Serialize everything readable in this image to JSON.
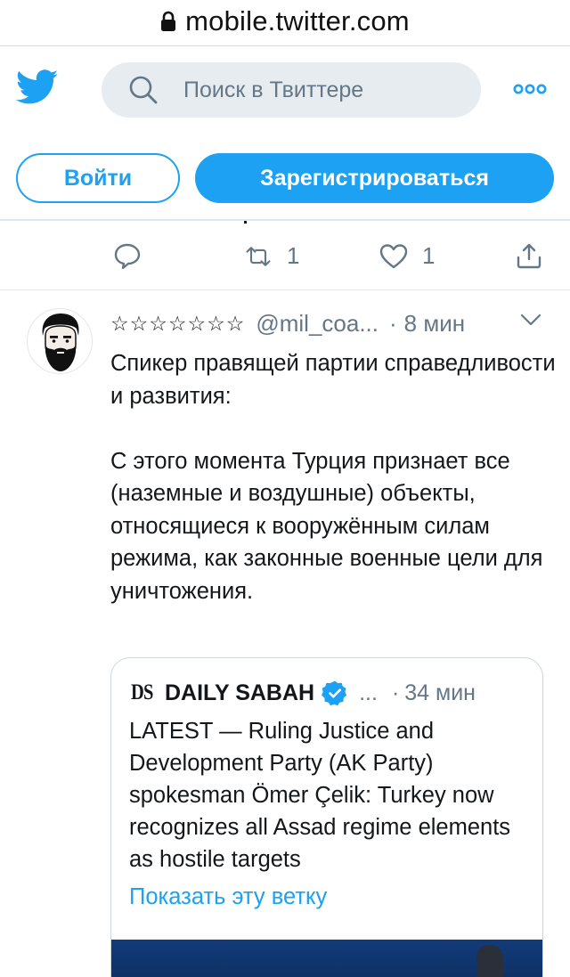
{
  "browser": {
    "url": "mobile.twitter.com"
  },
  "header": {
    "search_placeholder": "Поиск в Твиттере",
    "login_label": "Войти",
    "signup_label": "Зарегистрироваться"
  },
  "prev_tweet": {
    "retweets": "1",
    "likes": "1"
  },
  "tweet": {
    "name": "☆☆☆☆☆☆☆",
    "handle": "@mil_coa...",
    "separator": "·",
    "time": "8 мин",
    "text": "Спикер правящей партии справедливости и развития:\n\nС этого момента Турция признает все (наземные и воздушные) объекты, относящиеся к вооружённым силам режима, как законные военные цели для уничтожения."
  },
  "quoted": {
    "logo": "DS",
    "name": "DAILY SABAH",
    "ellipsis": "...",
    "separator": "·",
    "time": "34 мин",
    "text": "LATEST — Ruling Justice and Development Party (AK Party) spokesman Ömer Çelik: Turkey now recognizes all Assad regime elements as hostile targets",
    "show_thread": "Показать эту ветку"
  },
  "colors": {
    "brand": "#1da1f2",
    "muted": "#657786",
    "text": "#14171a"
  }
}
